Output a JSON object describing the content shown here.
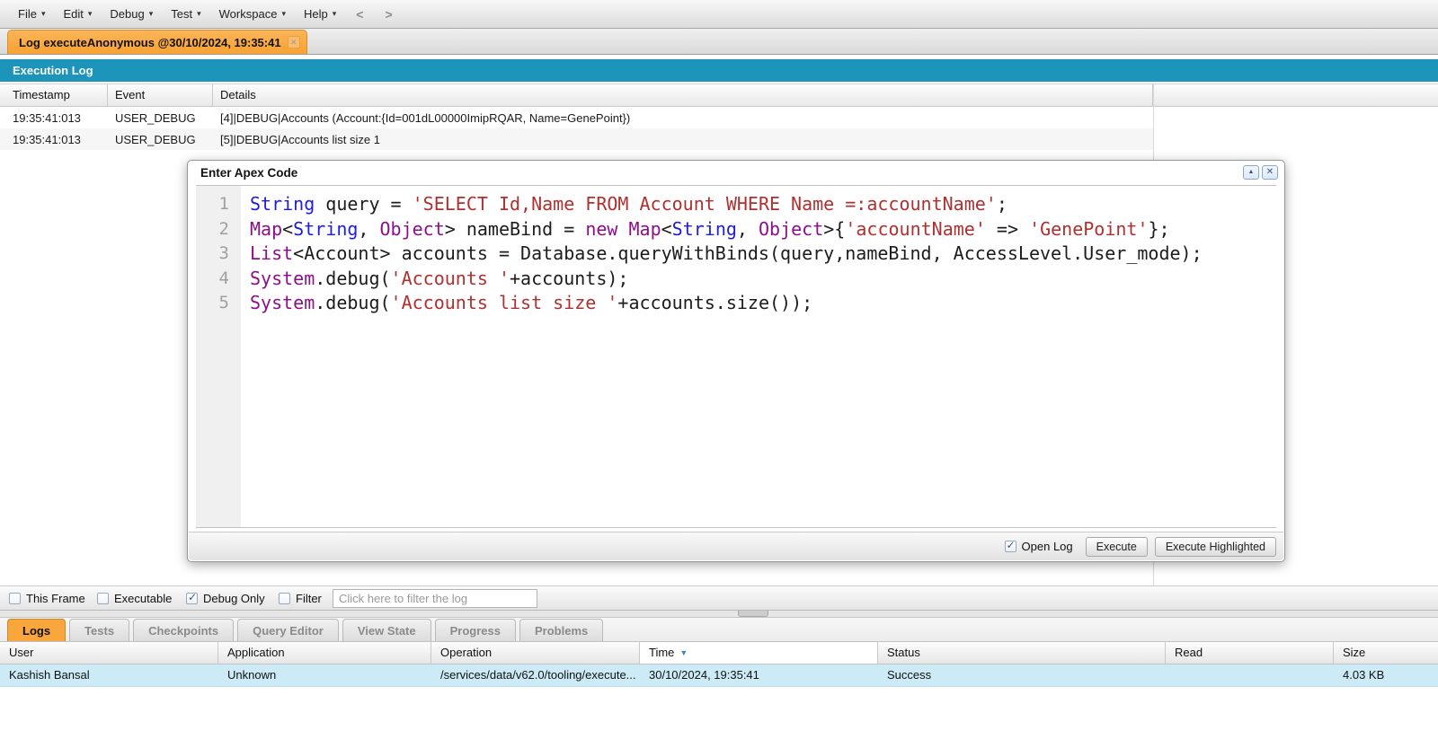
{
  "menu": {
    "items": [
      "File",
      "Edit",
      "Debug",
      "Test",
      "Workspace",
      "Help"
    ],
    "back": "<",
    "forward": ">"
  },
  "log_tab": {
    "label": "Log executeAnonymous @30/10/2024, 19:35:41",
    "close_icon": "✕"
  },
  "execution_log": {
    "title": "Execution Log",
    "columns": [
      "Timestamp",
      "Event",
      "Details"
    ],
    "rows": [
      {
        "timestamp": "19:35:41:013",
        "event": "USER_DEBUG",
        "details": "[4]|DEBUG|Accounts (Account:{Id=001dL00000ImipRQAR, Name=GenePoint})"
      },
      {
        "timestamp": "19:35:41:013",
        "event": "USER_DEBUG",
        "details": "[5]|DEBUG|Accounts list size 1"
      }
    ]
  },
  "apex_editor": {
    "title": "Enter Apex Code",
    "collapse_icon": "▲",
    "close_icon": "✕",
    "lines": [
      {
        "n": "1",
        "seg": [
          [
            "k",
            "String"
          ],
          [
            "p",
            " query = "
          ],
          [
            "s",
            "'SELECT Id,Name FROM Account WHERE Name =:accountName'"
          ],
          [
            "p",
            ";"
          ]
        ]
      },
      {
        "n": "2",
        "seg": [
          [
            "t",
            "Map"
          ],
          [
            "p",
            "<"
          ],
          [
            "k",
            "String"
          ],
          [
            "p",
            ", "
          ],
          [
            "t",
            "Object"
          ],
          [
            "p",
            "> nameBind = "
          ],
          [
            "t",
            "new"
          ],
          [
            "p",
            " "
          ],
          [
            "t",
            "Map"
          ],
          [
            "p",
            "<"
          ],
          [
            "k",
            "String"
          ],
          [
            "p",
            ", "
          ],
          [
            "t",
            "Object"
          ],
          [
            "p",
            ">{"
          ],
          [
            "s",
            "'accountName'"
          ],
          [
            "p",
            " => "
          ],
          [
            "s",
            "'GenePoint'"
          ],
          [
            "p",
            "};"
          ]
        ]
      },
      {
        "n": "3",
        "seg": [
          [
            "t",
            "List"
          ],
          [
            "p",
            "<Account> accounts = Database.queryWithBinds(query,nameBind, AccessLevel.User_mode);"
          ]
        ]
      },
      {
        "n": "4",
        "seg": [
          [
            "t",
            "System"
          ],
          [
            "p",
            ".debug("
          ],
          [
            "s",
            "'Accounts '"
          ],
          [
            "p",
            "+accounts);"
          ]
        ]
      },
      {
        "n": "5",
        "seg": [
          [
            "t",
            "System"
          ],
          [
            "p",
            ".debug("
          ],
          [
            "s",
            "'Accounts list size '"
          ],
          [
            "p",
            "+accounts.size());"
          ]
        ]
      }
    ],
    "open_log_label": "Open Log",
    "open_log_checked": true,
    "buttons": [
      "Execute",
      "Execute Highlighted"
    ]
  },
  "filter_bar": {
    "checkboxes": [
      {
        "label": "This Frame",
        "checked": false
      },
      {
        "label": "Executable",
        "checked": false
      },
      {
        "label": "Debug Only",
        "checked": true
      },
      {
        "label": "Filter",
        "checked": false
      }
    ],
    "filter_placeholder": "Click here to filter the log"
  },
  "bottom_tabs": [
    {
      "label": "Logs",
      "active": true
    },
    {
      "label": "Tests",
      "active": false
    },
    {
      "label": "Checkpoints",
      "active": false
    },
    {
      "label": "Query Editor",
      "active": false
    },
    {
      "label": "View State",
      "active": false
    },
    {
      "label": "Progress",
      "active": false
    },
    {
      "label": "Problems",
      "active": false
    }
  ],
  "logs_table": {
    "columns": [
      {
        "label": "User",
        "sorted": false
      },
      {
        "label": "Application",
        "sorted": false
      },
      {
        "label": "Operation",
        "sorted": false
      },
      {
        "label": "Time",
        "sorted": true,
        "sort_icon": "▼"
      },
      {
        "label": "Status",
        "sorted": false
      },
      {
        "label": "Read",
        "sorted": false
      },
      {
        "label": "Size",
        "sorted": false
      }
    ],
    "rows": [
      {
        "user": "Kashish Bansal",
        "application": "Unknown",
        "operation": "/services/data/v62.0/tooling/execute...",
        "time": "30/10/2024, 19:35:41",
        "status": "Success",
        "read": "",
        "size": "4.03 KB"
      }
    ]
  },
  "colors": {
    "header_teal": "#1d94ba",
    "tab_orange": "#f9a63c",
    "selected_row": "#cdebf7",
    "sort_arrow": "#3d85c6",
    "syntax": {
      "keyword": "#1d1de0",
      "type": "#8b0f8b",
      "string": "#b03030",
      "plain": "#1c1c1c"
    }
  }
}
